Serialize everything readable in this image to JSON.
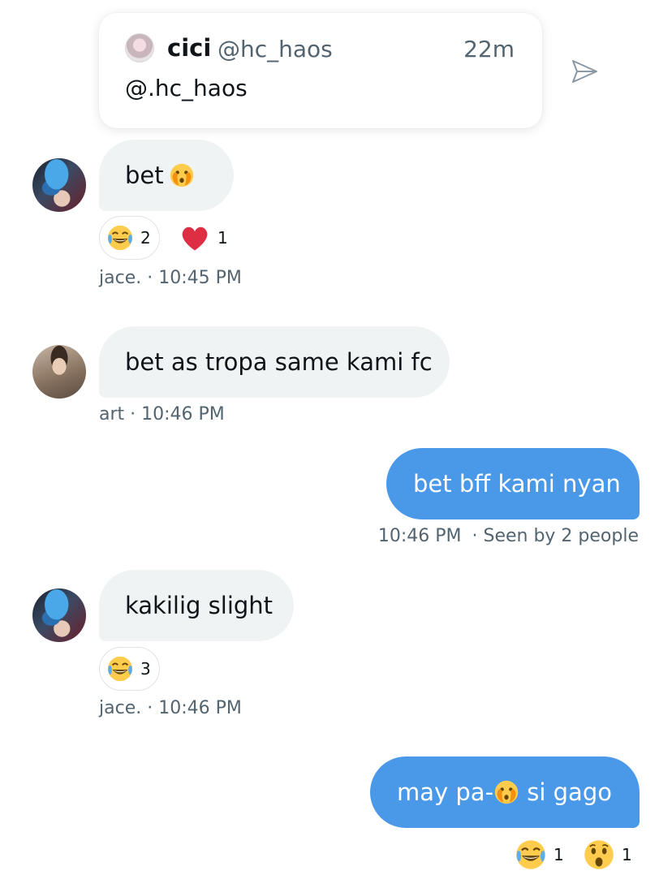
{
  "quoted_tweet": {
    "name": "cici",
    "handle": "@hc_haos",
    "time": "22m",
    "text": "@.hc_haos"
  },
  "icons": {
    "send": "send-icon",
    "laugh": "tears-of-joy-emoji",
    "heart": "red-heart-emoji",
    "peek": "face-with-open-eyes-and-hand-over-mouth-emoji",
    "shocked": "astonished-face-emoji"
  },
  "colors": {
    "outgoing_bubble": "#4a99e9",
    "incoming_bubble": "#eff3f4",
    "meta_text": "#536471"
  },
  "messages": [
    {
      "sender": "jace.",
      "text": "bet",
      "reactions": [
        {
          "emoji": "tears-of-joy-emoji",
          "count": "2"
        },
        {
          "emoji": "red-heart-emoji",
          "count": "1"
        }
      ],
      "meta": "jace. · 10:45 PM"
    },
    {
      "sender": "art",
      "text": "bet as tropa same kami fc",
      "meta": "art · 10:46 PM"
    },
    {
      "sender": "me",
      "text": "bet bff kami nyan",
      "meta_time": "10:46 PM",
      "meta_seen": "· Seen by 2 people"
    },
    {
      "sender": "jace.",
      "text": "kakilig slight",
      "reactions": [
        {
          "emoji": "tears-of-joy-emoji",
          "count": "3"
        }
      ],
      "meta": "jace. · 10:46 PM"
    },
    {
      "sender": "me",
      "text_before": "may pa-",
      "text_after": " si gago",
      "reactions": [
        {
          "emoji": "tears-of-joy-emoji",
          "count": "1"
        },
        {
          "emoji": "astonished-face-emoji",
          "count": "1"
        }
      ]
    }
  ]
}
